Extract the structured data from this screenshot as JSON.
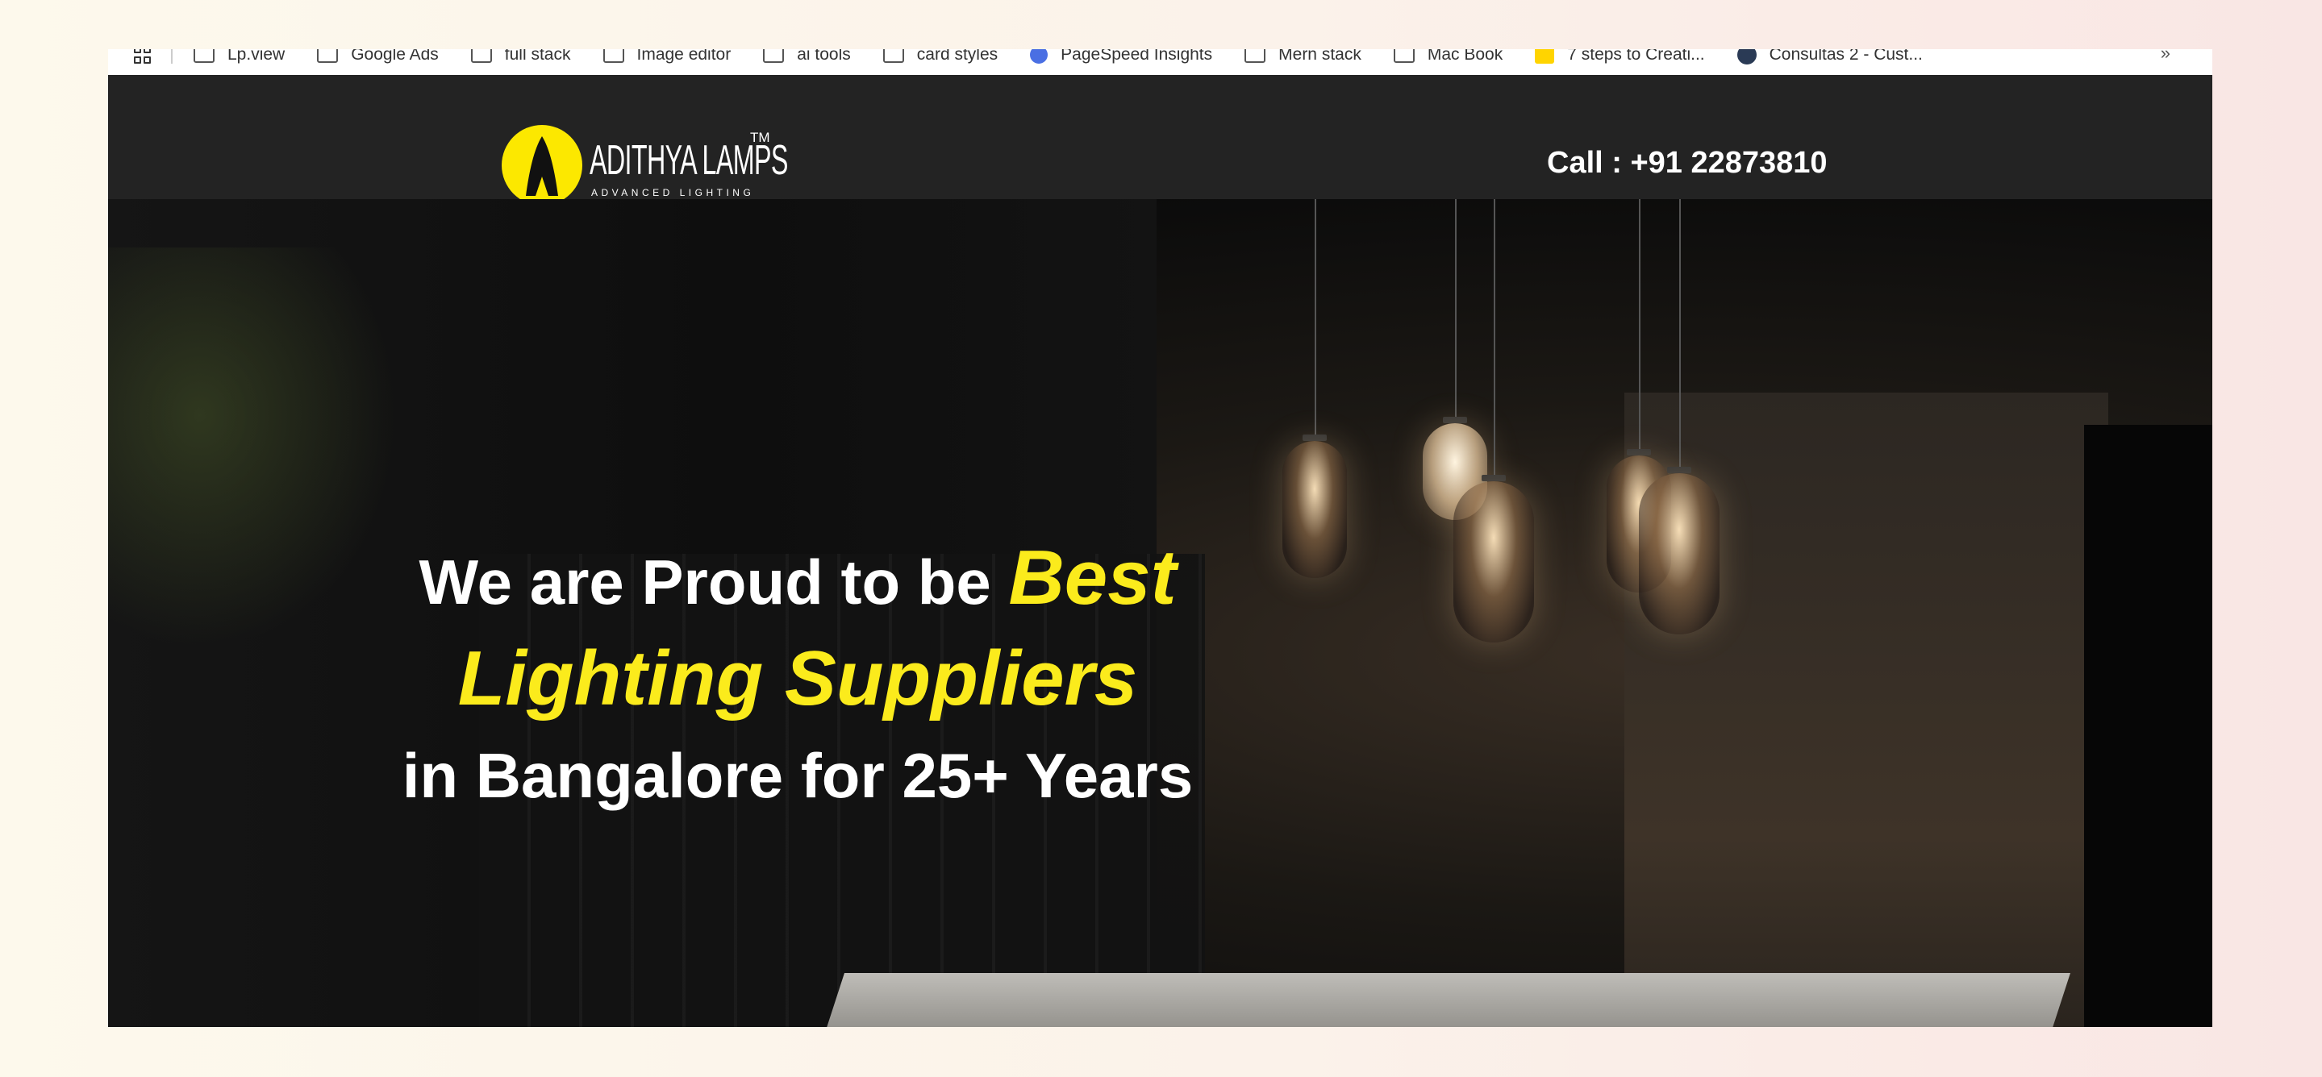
{
  "bookmarks_bar": {
    "items": [
      {
        "label": "Lp.view",
        "icon": "folder-icon"
      },
      {
        "label": "Google Ads",
        "icon": "folder-icon"
      },
      {
        "label": "full stack",
        "icon": "folder-icon"
      },
      {
        "label": "Image editor",
        "icon": "folder-icon"
      },
      {
        "label": "ai tools",
        "icon": "folder-icon"
      },
      {
        "label": "card styles",
        "icon": "folder-icon"
      },
      {
        "label": "PageSpeed Insights",
        "icon": "pagespeed-icon"
      },
      {
        "label": "Mern stack",
        "icon": "folder-icon"
      },
      {
        "label": "Mac Book",
        "icon": "folder-icon"
      },
      {
        "label": "7 steps to Creati...",
        "icon": "bookmark-icon"
      },
      {
        "label": "Consultas 2 - Cust...",
        "icon": "site-icon"
      }
    ],
    "more": "»"
  },
  "header": {
    "logo_name": "ADITHYA LAMPS",
    "logo_tm": "TM",
    "logo_tagline": "ADVANCED LIGHTING",
    "phone": "Call : +91 22873810"
  },
  "hero": {
    "line1_prefix": "We are Proud to be ",
    "line1_highlight": "Best",
    "line2_highlight": "Lighting Suppliers",
    "line3": "in Bangalore for 25+ Years"
  },
  "colors": {
    "accent_yellow": "#fbeb1c",
    "header_bg": "#232323",
    "logo_yellow": "#fce800"
  }
}
